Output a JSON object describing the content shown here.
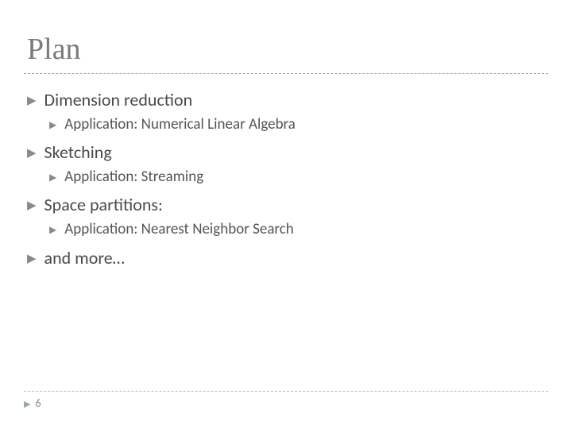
{
  "title": "Plan",
  "items": [
    {
      "label": "Dimension reduction",
      "children": [
        {
          "label": "Application: Numerical Linear Algebra"
        }
      ]
    },
    {
      "label": "Sketching",
      "children": [
        {
          "label": "Application: Streaming"
        }
      ]
    },
    {
      "label": "Space partitions:",
      "children": [
        {
          "label": "Application: Nearest Neighbor Search"
        }
      ]
    },
    {
      "label": "and more…",
      "children": []
    }
  ],
  "page_number": "6"
}
